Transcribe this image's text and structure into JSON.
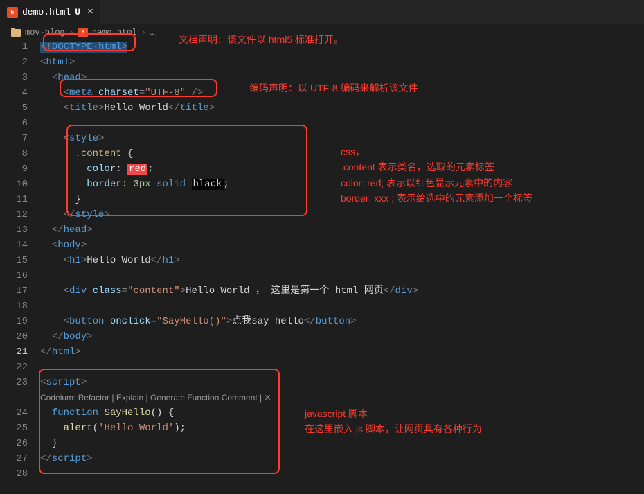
{
  "tab": {
    "icon_text": "5",
    "label": "demo.html",
    "status": "U",
    "close": "×"
  },
  "breadcrumb": {
    "folder": "mov-blog",
    "sep": "›",
    "file": "demo.html",
    "dots": "…"
  },
  "gutter": {
    "start": 1,
    "end": 28,
    "current": 21
  },
  "code": {
    "l1": {
      "a": "<!",
      "b": "DOCTYPE",
      "sp": "·",
      "c": "html",
      "d": ">"
    },
    "l2": {
      "a": "<",
      "b": "html",
      "c": ">"
    },
    "l3": {
      "a": "<",
      "b": "head",
      "c": ">"
    },
    "l4": {
      "a": "<",
      "b": "meta",
      "sp": " ",
      "c": "charset",
      "d": "=",
      "e": "\"UTF-8\"",
      "f": " />"
    },
    "l5": {
      "a": "<",
      "b": "title",
      "c": ">",
      "d": "Hello World",
      "e": "</",
      "f": "title",
      "g": ">"
    },
    "l7": {
      "a": "<",
      "b": "style",
      "c": ">"
    },
    "l8": {
      "a": ".content",
      "b": " {"
    },
    "l9": {
      "a": "color",
      "b": ": ",
      "c": "red",
      "d": ";"
    },
    "l10": {
      "a": "border",
      "b": ": ",
      "c": "3px",
      "sp": " ",
      "d": "solid",
      "sp2": " ",
      "e": "black",
      "f": ";"
    },
    "l11": {
      "a": "}"
    },
    "l12": {
      "a": "</",
      "b": "style",
      "c": ">"
    },
    "l13": {
      "a": "</",
      "b": "head",
      "c": ">"
    },
    "l14": {
      "a": "<",
      "b": "body",
      "c": ">"
    },
    "l15": {
      "a": "<",
      "b": "h1",
      "c": ">",
      "d": "Hello World",
      "e": "</",
      "f": "h1",
      "g": ">"
    },
    "l17": {
      "a": "<",
      "b": "div",
      "sp": " ",
      "c": "class",
      "d": "=",
      "e": "\"content\"",
      "f": ">",
      "g": "Hello World ， 这里是第一个 html 网页",
      "h": "</",
      "i": "div",
      "j": ">"
    },
    "l19": {
      "a": "<",
      "b": "button",
      "sp": " ",
      "c": "onclick",
      "d": "=",
      "e": "\"SayHello()\"",
      "f": ">",
      "g": "点我say hello",
      "h": "</",
      "i": "button",
      "j": ">"
    },
    "l20": {
      "a": "</",
      "b": "body",
      "c": ">"
    },
    "l21": {
      "a": "</",
      "b": "html",
      "c": ">"
    },
    "l23": {
      "a": "<",
      "b": "script",
      "c": ">"
    },
    "codelens": "Codeium: Refactor | Explain | Generate Function Comment | ✕",
    "l24": {
      "a": "function",
      "sp": " ",
      "b": "SayHello",
      "c": "() {"
    },
    "l25": {
      "a": "alert",
      "b": "(",
      "c": "'Hello World'",
      "d": ");"
    },
    "l26": {
      "a": "}"
    },
    "l27": {
      "a": "</",
      "b": "script",
      "c": ">"
    }
  },
  "annotations": {
    "a1": "文档声明：该文件以 html5 标准打开。",
    "a2": "编码声明：以 UTF-8 编码来解析该文件",
    "a3_l1": "css，",
    "a3_l2": ".content 表示类名，选取的元素标签",
    "a3_l3": "color: red;     表示以红色显示元素中的内容",
    "a3_l4": "border:  xxx ;   表示给选中的元素添加一个标签",
    "a4_l1": "javascript 脚本",
    "a4_l2": "在这里嵌入 js 脚本，让网页具有各种行为"
  }
}
